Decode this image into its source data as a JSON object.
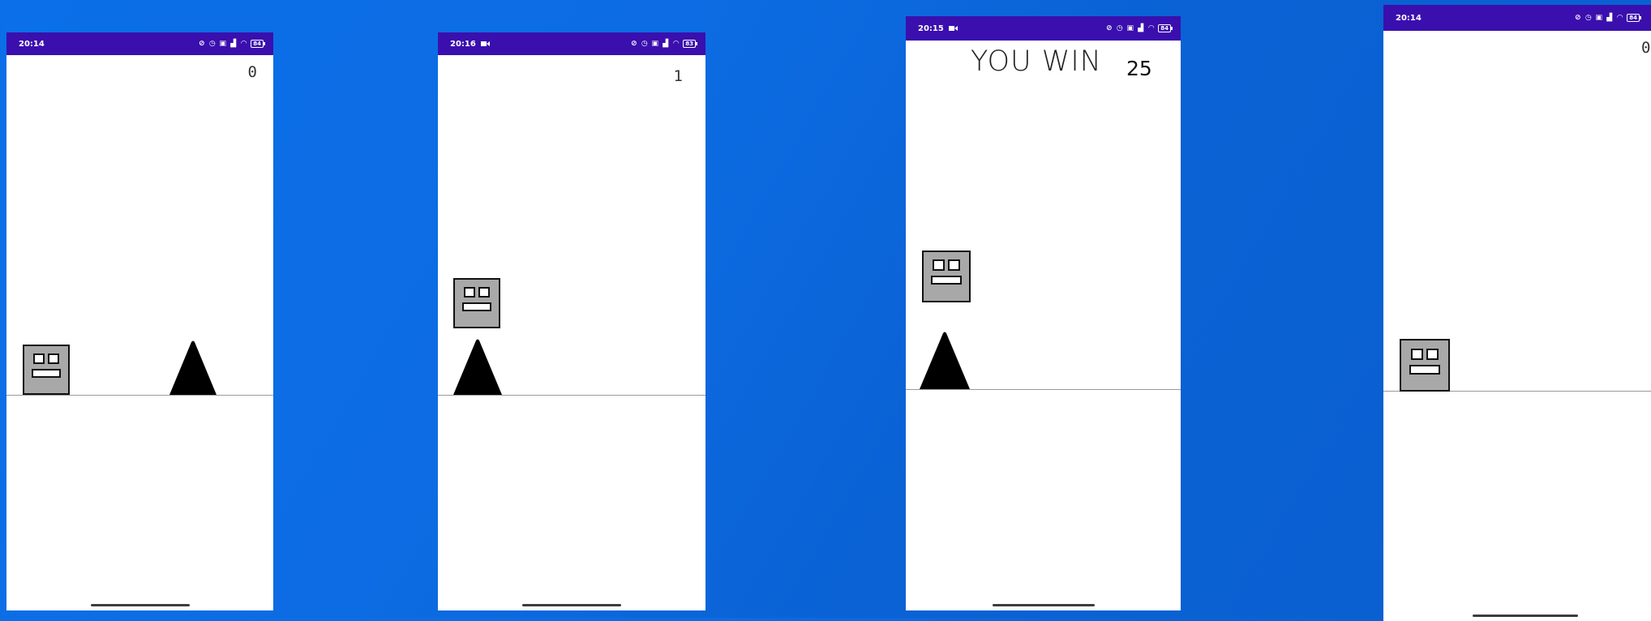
{
  "colors": {
    "background": "#0a6fe8",
    "status_bar": "#3a0fae",
    "player_fill": "#a8a8a8",
    "spike": "#000000"
  },
  "screens": [
    {
      "time": "20:14",
      "recording_icon": false,
      "status_icons": [
        "sync-off-icon",
        "alarm-icon",
        "sim-icon",
        "signal-icon",
        "wifi-icon",
        "battery-icon"
      ],
      "battery": "84",
      "score": "0",
      "message": "",
      "player_icon": "cube-face-icon",
      "obstacle_icon": "spike-icon"
    },
    {
      "time": "20:16",
      "recording_icon": true,
      "status_icons": [
        "sync-off-icon",
        "alarm-icon",
        "sim-icon",
        "signal-icon",
        "wifi-icon",
        "battery-icon"
      ],
      "battery": "83",
      "score": "1",
      "message": "",
      "player_icon": "cube-face-icon",
      "obstacle_icon": "spike-icon"
    },
    {
      "time": "20:15",
      "recording_icon": true,
      "status_icons": [
        "sync-off-icon",
        "alarm-icon",
        "sim-icon",
        "signal-icon",
        "wifi-icon",
        "battery-icon"
      ],
      "battery": "84",
      "score": "25",
      "message": "YOU WIN",
      "player_icon": "cube-face-icon",
      "obstacle_icon": "spike-icon"
    },
    {
      "time": "20:14",
      "recording_icon": false,
      "status_icons": [
        "sync-off-icon",
        "alarm-icon",
        "sim-icon",
        "signal-icon",
        "wifi-icon",
        "battery-icon"
      ],
      "battery": "84",
      "score": "0",
      "message": "",
      "player_icon": "cube-face-icon",
      "obstacle_icon": ""
    }
  ]
}
